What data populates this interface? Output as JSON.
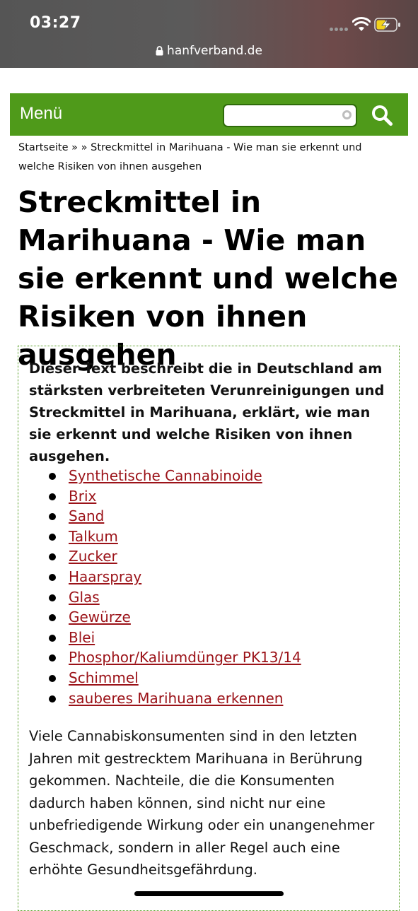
{
  "status_bar": {
    "time": "03:27"
  },
  "browser": {
    "url": "hanfverband.de"
  },
  "menubar": {
    "menu_label": "Menü",
    "search_value": ""
  },
  "breadcrumb": {
    "home": "Startseite",
    "separator": "»",
    "current": "» Streckmittel in Marihuana - Wie man sie erkennt und welche Risiken von ihnen ausgehen"
  },
  "page": {
    "title": "Streckmittel in Marihuana - Wie man sie erkennt und welche Risiken von ihnen ausgehen",
    "intro": "Dieser Text beschreibt die in Deutschland am stärksten verbreiteten Verunreinigungen und Streckmittel in Marihuana, erklärt, wie man sie erkennt und welche Risiken von ihnen ausgehen.",
    "toc": [
      "Synthetische Cannabinoide",
      "Brix",
      "Sand",
      "Talkum",
      "Zucker",
      "Haarspray",
      "Glas",
      "Gewürze",
      "Blei",
      "Phosphor/Kaliumdünger PK13/14",
      "Schimmel",
      "sauberes Marihuana erkennen"
    ],
    "body": "Viele Cannabiskonsumenten sind in den letzten Jahren mit gestrecktem Marihuana in Berührung gekommen. Nachteile, die die Konsumenten dadurch haben können, sind nicht nur eine unbefriedigende Wirkung oder ein unangenehmer Geschmack, sondern in aller Regel auch eine erhöhte Gesundheitsgefährdung."
  },
  "colors": {
    "brand_green": "#4f9a1a",
    "link_red": "#9b1218"
  }
}
